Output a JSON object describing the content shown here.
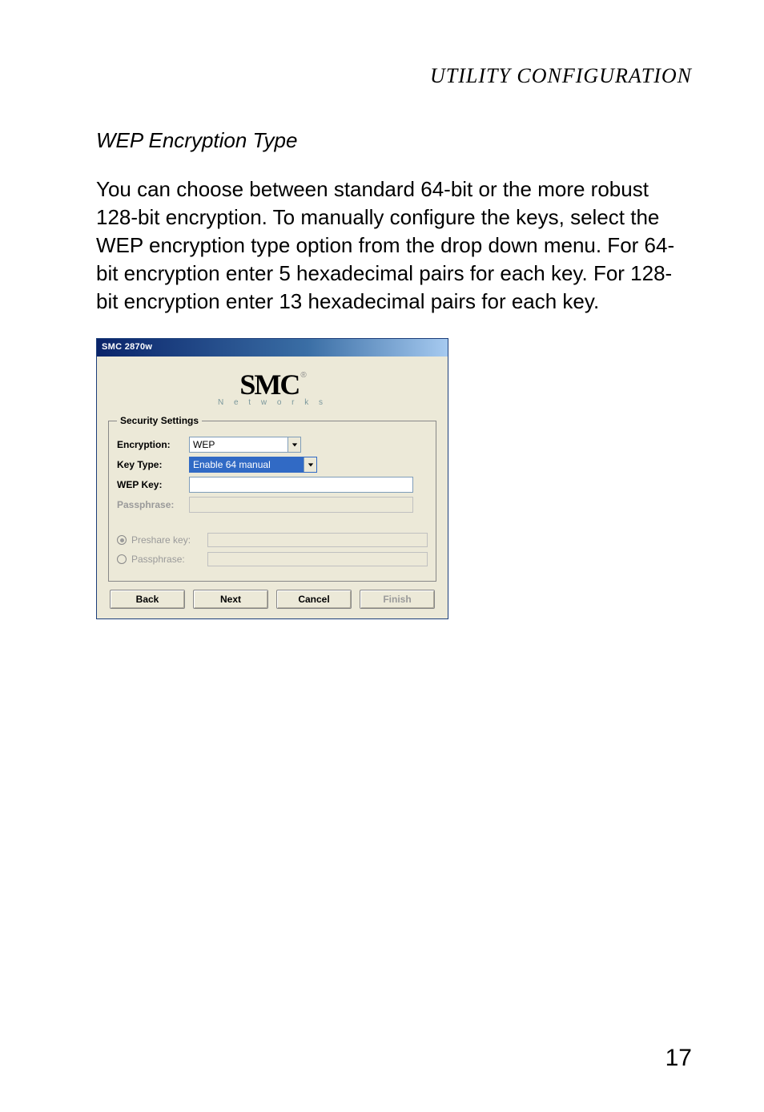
{
  "header": {
    "running": "UTILITY CONFIGURATION"
  },
  "section": {
    "title": "WEP Encryption Type"
  },
  "body": {
    "paragraph": "You can choose between standard 64-bit or the more robust 128-bit encryption. To manually configure the keys, select the WEP encryption type option from the drop down menu. For 64-bit encryption enter 5 hexadecimal pairs for each key. For 128-bit encryption enter 13 hexadecimal pairs for each key."
  },
  "dialog": {
    "title": "SMC 2870w",
    "logo": {
      "brand": "SMC",
      "reg": "®",
      "sub": "N e t w o r k s"
    },
    "fieldset_legend": "Security Settings",
    "labels": {
      "encryption": "Encryption:",
      "key_type": "Key Type:",
      "wep_key": "WEP Key:",
      "passphrase_disabled": "Passphrase:",
      "preshare_radio": "Preshare key:",
      "passphrase_radio": "Passphrase:"
    },
    "values": {
      "encryption": "WEP",
      "key_type": "Enable 64 manual",
      "wep_key": "",
      "passphrase_disabled": "",
      "preshare_radio_field": "",
      "passphrase_radio_field": ""
    },
    "buttons": {
      "back": "Back",
      "next": "Next",
      "cancel": "Cancel",
      "finish": "Finish"
    }
  },
  "page_number": "17"
}
